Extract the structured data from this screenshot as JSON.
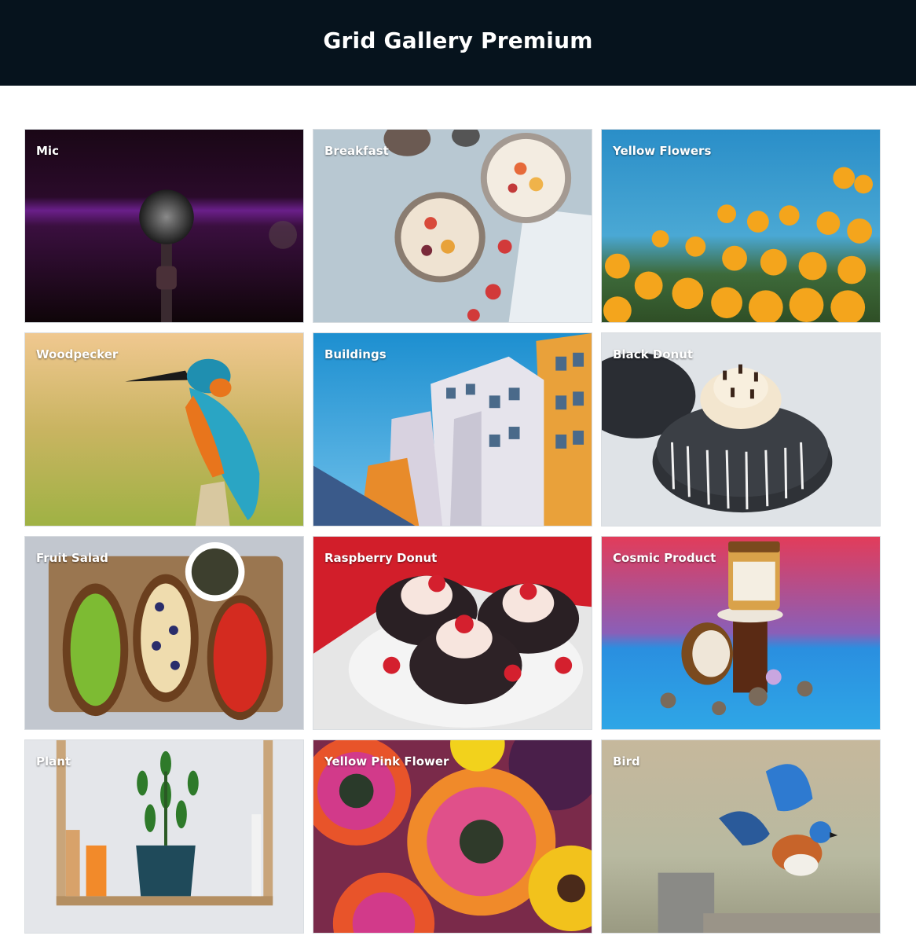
{
  "header": {
    "title": "Grid Gallery Premium"
  },
  "gallery": {
    "items": [
      {
        "label": "Mic",
        "icon": "microphone-icon"
      },
      {
        "label": "Breakfast",
        "icon": "breakfast-bowl-icon"
      },
      {
        "label": "Yellow Flowers",
        "icon": "flower-icon"
      },
      {
        "label": "Woodpecker",
        "icon": "bird-icon"
      },
      {
        "label": "Buildings",
        "icon": "building-icon"
      },
      {
        "label": "Black Donut",
        "icon": "donut-icon"
      },
      {
        "label": "Fruit Salad",
        "icon": "toast-icon"
      },
      {
        "label": "Raspberry Donut",
        "icon": "donut-icon"
      },
      {
        "label": "Cosmic Product",
        "icon": "candle-jar-icon"
      },
      {
        "label": "Plant",
        "icon": "plant-icon"
      },
      {
        "label": "Yellow Pink Flower",
        "icon": "daisy-icon"
      },
      {
        "label": "Bird",
        "icon": "bird-icon"
      }
    ]
  },
  "colors": {
    "header_bg": "#06131d",
    "header_text": "#ffffff",
    "page_bg": "#ffffff"
  }
}
